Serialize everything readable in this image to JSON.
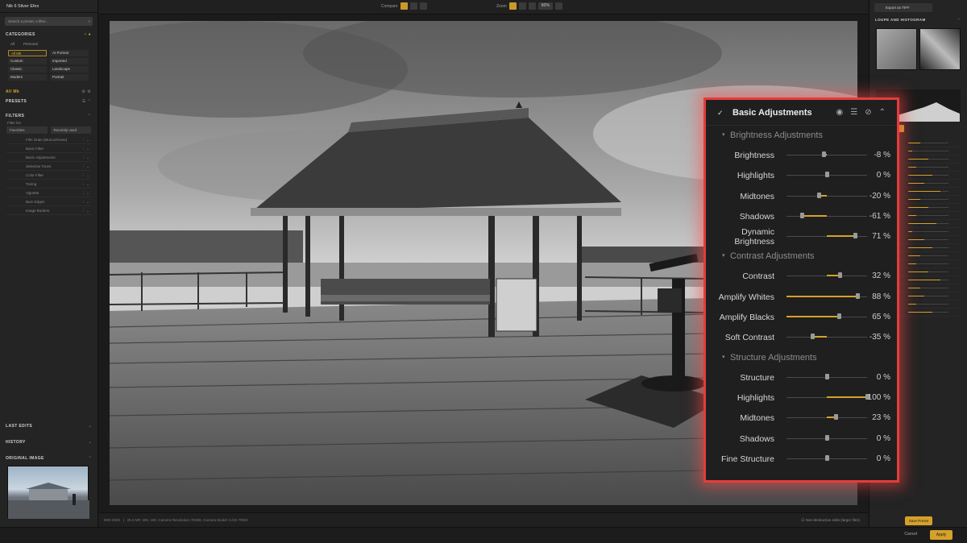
{
  "app": {
    "title": "Nik 6 Silver Efex"
  },
  "left_panel": {
    "search_placeholder": "Search a preset, a filter...",
    "categories_header": "CATEGORIES",
    "category_tabs": [
      "All",
      "Personal"
    ],
    "categories": [
      "All Mk",
      "AI Portrait",
      "Custom",
      "Imported",
      "Classic",
      "Landscape",
      "Modern",
      "Portrait"
    ],
    "selected_label": "All Mk",
    "presets_header": "PRESETS",
    "filters_header": "FILTERS",
    "filters_sub": "Filter list",
    "filter_buttons": [
      "Favorites",
      "Recently used"
    ],
    "filter_items": [
      "Film Grain (Monochrome)",
      "Basic Filter",
      "Basic Adjustments",
      "Selective Tones",
      "Color Filter",
      "Toning",
      "Vignette",
      "Burn Edges",
      "Image Borders"
    ],
    "last_edits": "LAST EDITS",
    "history": "HISTORY",
    "original_image": "ORIGINAL IMAGE"
  },
  "toolbar": {
    "compare_label": "Compare",
    "zoom_label": "Zoom",
    "zoom_value": "60%"
  },
  "status": {
    "file": "IMG-0925",
    "info": "25.6 MP, 300, 180, Camera Resolution: RGB8, Camera Model: ILCE-7RM2",
    "nondestructive": "Non-destructive edits (larger files)"
  },
  "right_panel": {
    "export_label": "Export as TIFF",
    "loupe_header": "LOUPE AND HISTOGRAM",
    "save_preset": "Save Preset"
  },
  "bottom": {
    "cancel": "Cancel",
    "apply": "Apply"
  },
  "adjustments": {
    "title": "Basic Adjustments",
    "groups": [
      {
        "name": "Brightness Adjustments",
        "rows": [
          {
            "label": "Brightness",
            "value": "-8 %",
            "pct": -8
          },
          {
            "label": "Highlights",
            "value": "0 %",
            "pct": 0
          },
          {
            "label": "Midtones",
            "value": "-20 %",
            "pct": -20
          },
          {
            "label": "Shadows",
            "value": "-61 %",
            "pct": -61
          },
          {
            "label": "Dynamic\nBrightness",
            "value": "71 %",
            "pct": 71
          }
        ]
      },
      {
        "name": "Contrast Adjustments",
        "rows": [
          {
            "label": "Contrast",
            "value": "32 %",
            "pct": 32
          },
          {
            "label": "Amplify Whites",
            "value": "88 %",
            "pct": 88,
            "from_left": true
          },
          {
            "label": "Amplify Blacks",
            "value": "65 %",
            "pct": 65,
            "from_left": true
          },
          {
            "label": "Soft Contrast",
            "value": "-35 %",
            "pct": -35
          }
        ]
      },
      {
        "name": "Structure Adjustments",
        "rows": [
          {
            "label": "Structure",
            "value": "0 %",
            "pct": 0
          },
          {
            "label": "Highlights",
            "value": "100 %",
            "pct": 100
          },
          {
            "label": "Midtones",
            "value": "23 %",
            "pct": 23
          },
          {
            "label": "Shadows",
            "value": "0 %",
            "pct": 0
          },
          {
            "label": "Fine Structure",
            "value": "0 %",
            "pct": 0
          }
        ]
      }
    ]
  },
  "colors": {
    "accent": "#d6a12a",
    "highlight_border": "#e23d3d"
  }
}
